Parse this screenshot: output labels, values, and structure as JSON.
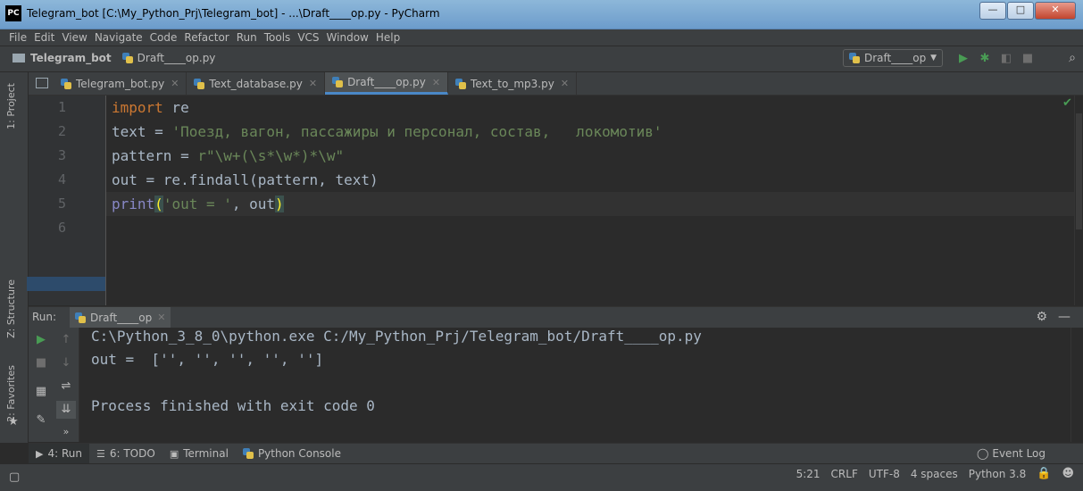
{
  "window": {
    "title": "Telegram_bot [C:\\My_Python_Prj\\Telegram_bot] - ...\\Draft____op.py - PyCharm",
    "logo": "PC"
  },
  "menu": [
    "File",
    "Edit",
    "View",
    "Navigate",
    "Code",
    "Refactor",
    "Run",
    "Tools",
    "VCS",
    "Window",
    "Help"
  ],
  "breadcrumb": {
    "project": "Telegram_bot",
    "file": "Draft____op.py"
  },
  "run_config": {
    "label": "Draft____op"
  },
  "tabs": [
    {
      "label": "Telegram_bot.py",
      "active": false
    },
    {
      "label": "Text_database.py",
      "active": false
    },
    {
      "label": "Draft____op.py",
      "active": true
    },
    {
      "label": "Text_to_mp3.py",
      "active": false
    }
  ],
  "editor": {
    "line_numbers": [
      "1",
      "2",
      "3",
      "4",
      "5",
      "6"
    ],
    "lines": {
      "l1": {
        "kw": "import",
        "rest": " re"
      },
      "l2": {
        "pre": "text = ",
        "str": "'Поезд, вагон, пассажиры и персонал, состав,   локомотив'"
      },
      "l3": {
        "pre": "pattern = ",
        "str": "r\"\\w+(\\s*\\w*)*\\w\""
      },
      "l4": {
        "pre": "out = re.findall(pattern, text)"
      },
      "l5": {
        "builtin": "print",
        "open": "(",
        "str": "'out = '",
        "mid": ", out",
        "close": ")"
      }
    }
  },
  "side_tabs": {
    "project": "1: Project",
    "structure": "Z: Structure",
    "favorites": "2: Favorites"
  },
  "run_panel": {
    "title": "Run:",
    "tab_label": "Draft____op",
    "console": [
      "C:\\Python_3_8_0\\python.exe C:/My_Python_Prj/Telegram_bot/Draft____op.py",
      "out =  ['', '', '', '', '']",
      "",
      "Process finished with exit code 0"
    ]
  },
  "bottom_tools": [
    {
      "label": "4: Run",
      "icon": "play-icon"
    },
    {
      "label": "6: TODO",
      "icon": "list-icon"
    },
    {
      "label": "Terminal",
      "icon": "terminal-icon"
    },
    {
      "label": "Python Console",
      "icon": "python-icon"
    }
  ],
  "event_log": "Event Log",
  "status": {
    "position": "5:21",
    "line_sep": "CRLF",
    "encoding": "UTF-8",
    "indent": "4 spaces",
    "interpreter": "Python 3.8"
  },
  "colors": {
    "keyword": "#cc7832",
    "string": "#6a8759",
    "builtin": "#8888c6",
    "accent": "#4a88c7",
    "run_green": "#499c54"
  }
}
